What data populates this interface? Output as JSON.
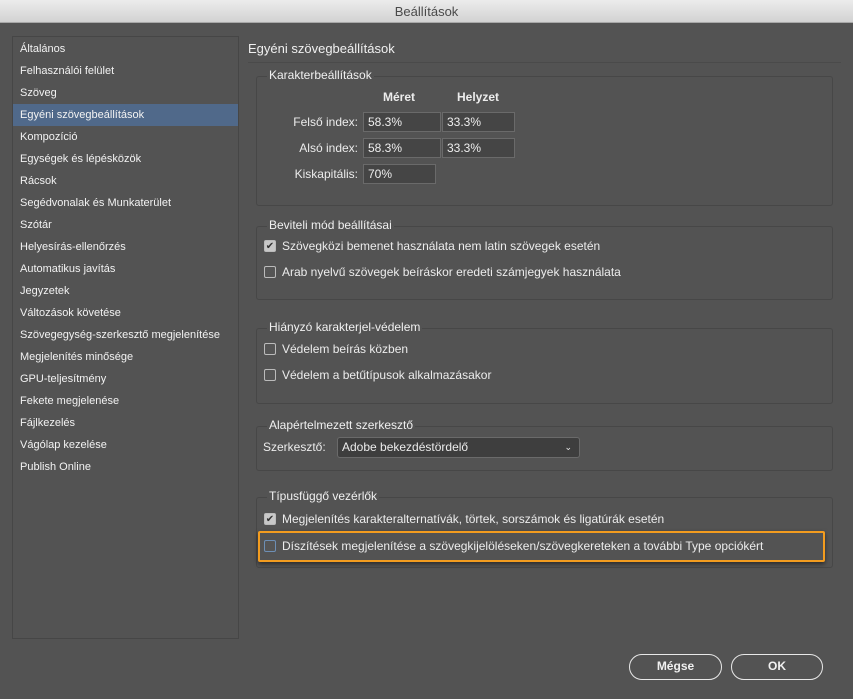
{
  "window": {
    "title": "Beállítások"
  },
  "sidebar": {
    "items": [
      "Általános",
      "Felhasználói felület",
      "Szöveg",
      "Egyéni szövegbeállítások",
      "Kompozíció",
      "Egységek és lépésközök",
      "Rácsok",
      "Segédvonalak és Munkaterület",
      "Szótár",
      "Helyesírás-ellenőrzés",
      "Automatikus javítás",
      "Jegyzetek",
      "Változások követése",
      "Szövegegység-szerkesztő megjelenítése",
      "Megjelenítés minősége",
      "GPU-teljesítmény",
      "Fekete megjelenése",
      "Fájlkezelés",
      "Vágólap kezelése",
      "Publish Online"
    ],
    "selected": "Egyéni szövegbeállítások"
  },
  "main": {
    "heading": "Egyéni szövegbeállítások",
    "character": {
      "legend": "Karakterbeállítások",
      "col_size": "Méret",
      "col_position": "Helyzet",
      "superscript_label": "Felső index:",
      "superscript_size": "58.3%",
      "superscript_position": "33.3%",
      "subscript_label": "Alsó index:",
      "subscript_size": "58.3%",
      "subscript_position": "33.3%",
      "smallcaps_label": "Kiskapitális:",
      "smallcaps_value": "70%"
    },
    "input": {
      "legend": "Beviteli mód beállításai",
      "opt1": "Szövegközi bemenet használata nem latin szövegek esetén",
      "opt1_checked": true,
      "opt2": "Arab nyelvű szövegek beíráskor eredeti számjegyek használata",
      "opt2_checked": false
    },
    "glyph": {
      "legend": "Hiányzó karakterjel-védelem",
      "opt1": "Védelem beírás közben",
      "opt2": "Védelem a betűtípusok alkalmazásakor"
    },
    "editor": {
      "legend": "Alapértelmezett szerkesztő",
      "label": "Szerkesztő:",
      "value": "Adobe bekezdéstördelő"
    },
    "type": {
      "legend": "Típusfüggő vezérlők",
      "opt1": "Megjelenítés karakteralternatívák, törtek, sorszámok és ligatúrák esetén",
      "opt1_checked": true,
      "opt2": "Díszítések megjelenítése a szövegkijelöléseken/szövegkereteken a további Type opciókért",
      "opt2_checked": false
    }
  },
  "buttons": {
    "cancel": "Mégse",
    "ok": "OK"
  },
  "colors": {
    "highlight": "#f39c1f",
    "selection": "#50698a"
  }
}
